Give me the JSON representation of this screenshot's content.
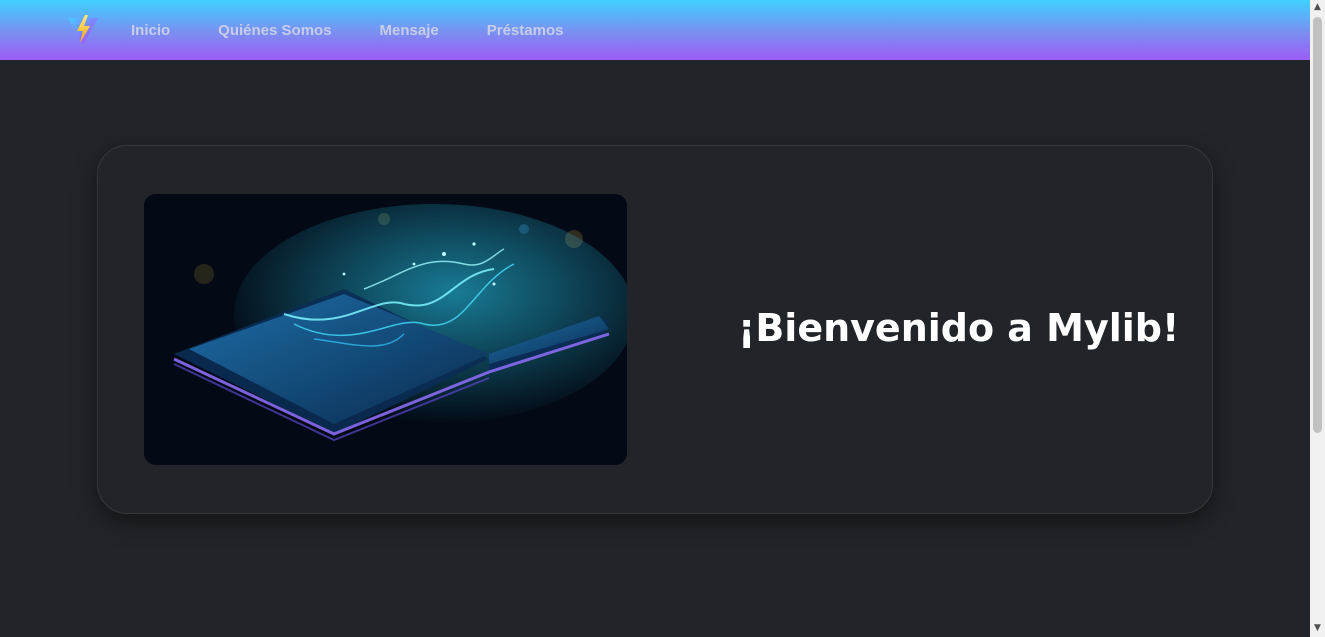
{
  "nav": {
    "logo_icon": "lightning-logo-icon",
    "links": [
      "Inicio",
      "Quiénes Somos",
      "Mensaje",
      "Préstamos"
    ]
  },
  "hero": {
    "image_alt": "glowing-open-book-image",
    "welcome": "¡Bienvenido a Mylib!"
  },
  "colors": {
    "nav_top": "#3fd0ff",
    "nav_bottom": "#9c5cf5",
    "page_bg": "#212429",
    "text": "#ffffff"
  }
}
